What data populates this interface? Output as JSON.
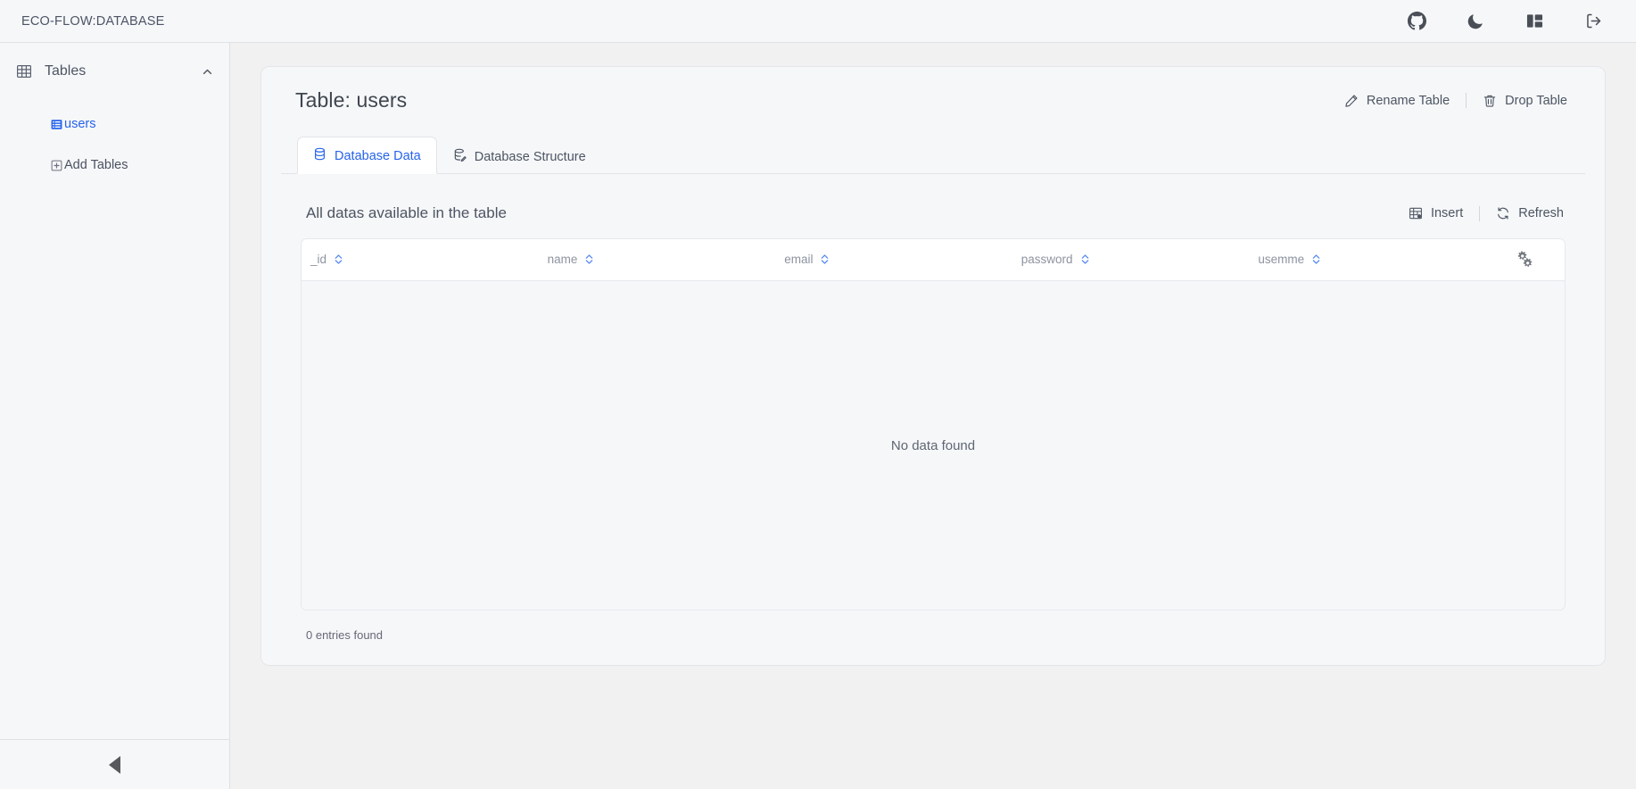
{
  "topbar": {
    "brand": "ECO-FLOW:DATABASE",
    "icons": [
      {
        "name": "github-icon",
        "label": "GitHub"
      },
      {
        "name": "moon-icon",
        "label": "Dark mode"
      },
      {
        "name": "panel-layout-icon",
        "label": "Toggle layout"
      },
      {
        "name": "logout-icon",
        "label": "Logout"
      }
    ]
  },
  "sidebar": {
    "header": {
      "title": "Tables",
      "icon": "table-icon",
      "chevron": "chevron-up-icon"
    },
    "items": [
      {
        "label": "users",
        "icon": "table-rows-icon",
        "active": true
      },
      {
        "label": "Add Tables",
        "icon": "plus-square-icon",
        "active": false
      }
    ],
    "collapse": {
      "icon": "triangle-left-icon",
      "label": "Collapse sidebar"
    }
  },
  "panel": {
    "title": "Table: users",
    "actions": [
      {
        "label": "Rename Table",
        "icon": "pencil-icon"
      },
      {
        "label": "Drop Table",
        "icon": "trash-icon"
      }
    ],
    "tabs": [
      {
        "label": "Database Data",
        "icon": "database-icon",
        "active": true
      },
      {
        "label": "Database Structure",
        "icon": "database-structure-icon",
        "active": false
      }
    ],
    "section": {
      "title": "All datas available in the table",
      "actions": [
        {
          "label": "Insert",
          "icon": "table-insert-icon"
        },
        {
          "label": "Refresh",
          "icon": "refresh-icon"
        }
      ]
    },
    "table": {
      "columns": [
        {
          "label": "_id",
          "sortable": true
        },
        {
          "label": "name",
          "sortable": true
        },
        {
          "label": "email",
          "sortable": true
        },
        {
          "label": "password",
          "sortable": true
        },
        {
          "label": "usemme",
          "sortable": true
        }
      ],
      "settings_icon": "gears-icon",
      "rows": [],
      "empty_message": "No data found",
      "entries_text": "0 entries found"
    }
  },
  "colors": {
    "accent": "#2563eb",
    "sort_icon": "#5b8def",
    "page_bg": "#f1f1f1",
    "surface": "#f6f7f9",
    "border": "#e4e6ea",
    "text_primary": "#3f4650",
    "text_muted": "#8d93a0"
  }
}
